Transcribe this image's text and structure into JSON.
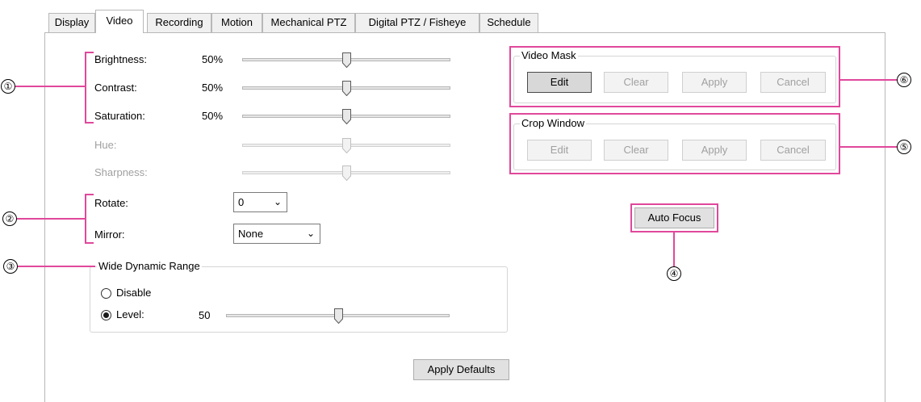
{
  "tabs": [
    {
      "label": "Display",
      "active": false
    },
    {
      "label": "Video",
      "active": true
    },
    {
      "label": "Recording",
      "active": false
    },
    {
      "label": "Motion",
      "active": false
    },
    {
      "label": "Mechanical PTZ",
      "active": false
    },
    {
      "label": "Digital PTZ / Fisheye",
      "active": false
    },
    {
      "label": "Schedule",
      "active": false
    }
  ],
  "image_settings": {
    "brightness": {
      "label": "Brightness:",
      "value_text": "50%",
      "level": 0.5
    },
    "contrast": {
      "label": "Contrast:",
      "value_text": "50%",
      "level": 0.5
    },
    "saturation": {
      "label": "Saturation:",
      "value_text": "50%",
      "level": 0.5
    },
    "hue": {
      "label": "Hue:",
      "level": 0.5,
      "disabled": true
    },
    "sharpness": {
      "label": "Sharpness:",
      "level": 0.5,
      "disabled": true
    }
  },
  "orientation": {
    "rotate": {
      "label": "Rotate:",
      "value": "0"
    },
    "mirror": {
      "label": "Mirror:",
      "value": "None"
    }
  },
  "wdr": {
    "title": "Wide Dynamic Range",
    "disable_label": "Disable",
    "level_label": "Level:",
    "level_value": "50",
    "selected": "level",
    "level": 0.5
  },
  "apply_defaults_label": "Apply Defaults",
  "video_mask": {
    "title": "Video Mask",
    "buttons": {
      "edit": "Edit",
      "clear": "Clear",
      "apply": "Apply",
      "cancel": "Cancel"
    }
  },
  "crop_window": {
    "title": "Crop Window",
    "buttons": {
      "edit": "Edit",
      "clear": "Clear",
      "apply": "Apply",
      "cancel": "Cancel"
    }
  },
  "auto_focus_label": "Auto Focus",
  "callouts": {
    "c1": "①",
    "c2": "②",
    "c3": "③",
    "c4": "④",
    "c5": "⑤",
    "c6": "⑥"
  },
  "colors": {
    "callout": "#e0489b",
    "disabled_text": "#a0a0a0"
  },
  "icons": {
    "dropdown": "chevron-down-icon",
    "slider_thumb": "slider-thumb-icon"
  }
}
